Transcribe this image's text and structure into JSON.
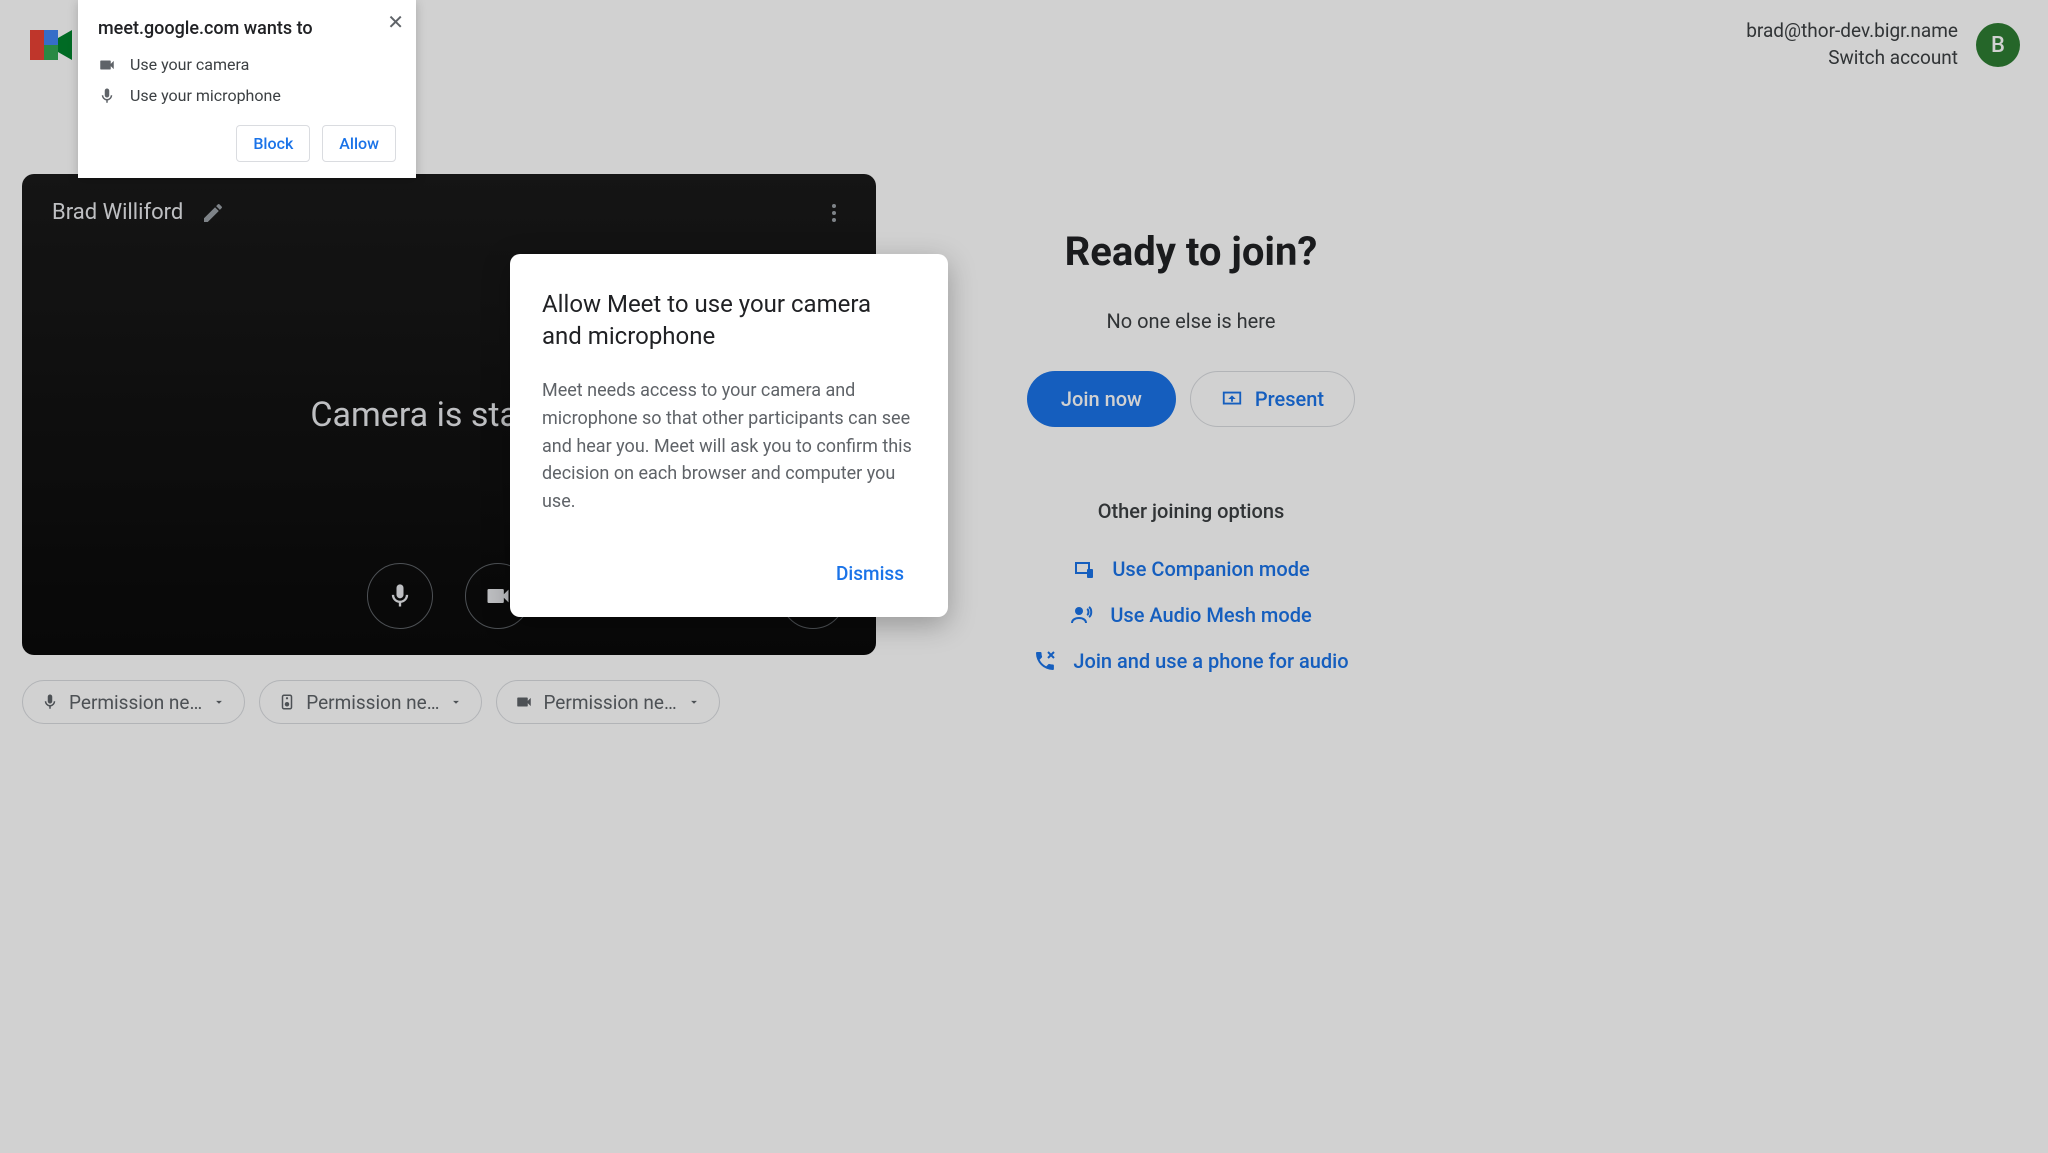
{
  "header": {
    "email": "brad@thor-dev.bigr.name",
    "switch_account_label": "Switch account",
    "avatar_initial": "B"
  },
  "video": {
    "user_name": "Brad Williford",
    "status_text": "Camera is starting"
  },
  "permission_chips": {
    "mic": "Permission ne…",
    "speaker": "Permission ne…",
    "camera": "Permission ne…"
  },
  "right": {
    "title": "Ready to join?",
    "presence": "No one else is here",
    "join_label": "Join now",
    "present_label": "Present",
    "other_heading": "Other joining options",
    "companion_label": "Use Companion mode",
    "audio_mesh_label": "Use Audio Mesh mode",
    "phone_label": "Join and use a phone for audio"
  },
  "browser_popup": {
    "site_line": "meet.google.com wants to",
    "camera_line": "Use your camera",
    "mic_line": "Use your microphone",
    "block_label": "Block",
    "allow_label": "Allow"
  },
  "meet_modal": {
    "title": "Allow Meet to use your camera and microphone",
    "body": "Meet needs access to your camera and microphone so that other participants can see and hear you. Meet will ask you to confirm this decision on each browser and computer you use.",
    "dismiss_label": "Dismiss"
  }
}
